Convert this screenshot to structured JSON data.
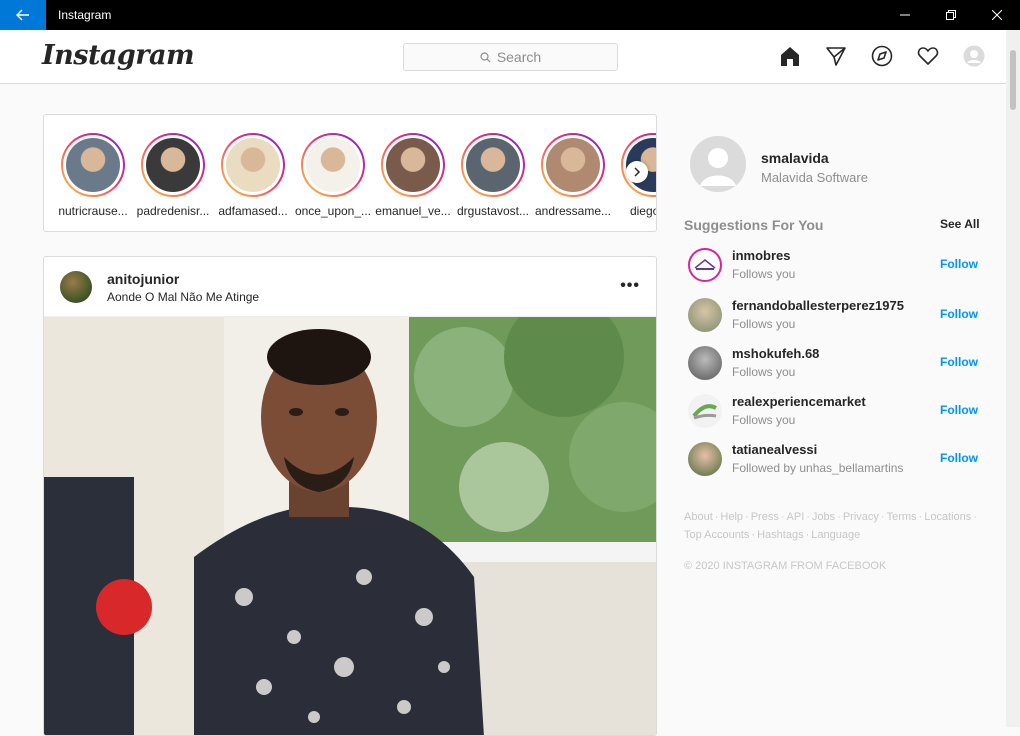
{
  "window": {
    "title": "Instagram"
  },
  "header": {
    "logo": "Instagram",
    "search_placeholder": "Search"
  },
  "stories": [
    {
      "username": "nutricrause...",
      "color": "#6b7a8a"
    },
    {
      "username": "padredenisr...",
      "color": "#3a3a3a"
    },
    {
      "username": "adfamased...",
      "color": "#e9dcc0"
    },
    {
      "username": "once_upon_...",
      "color": "#f4f1ea"
    },
    {
      "username": "emanuel_ve...",
      "color": "#7a5a4a"
    },
    {
      "username": "drgustavost...",
      "color": "#5a6570"
    },
    {
      "username": "andressame...",
      "color": "#b08a70"
    },
    {
      "username": "diego_...",
      "color": "#2a3a5a"
    }
  ],
  "post": {
    "username": "anitojunior",
    "location": "Aonde O Mal Não Me Atinge",
    "more": "•••"
  },
  "profile": {
    "username": "smalavida",
    "full_name": "Malavida Software"
  },
  "suggestions": {
    "title": "Suggestions For You",
    "see_all": "See All",
    "items": [
      {
        "username": "inmobres",
        "subtitle": "Follows you",
        "action": "Follow"
      },
      {
        "username": "fernandoballesterperez1975",
        "subtitle": "Follows you",
        "action": "Follow"
      },
      {
        "username": "mshokufeh.68",
        "subtitle": "Follows you",
        "action": "Follow"
      },
      {
        "username": "realexperiencemarket",
        "subtitle": "Follows you",
        "action": "Follow"
      },
      {
        "username": "tatianealvessi",
        "subtitle": "Followed by unhas_bellamartins",
        "action": "Follow"
      }
    ]
  },
  "footer": {
    "links": [
      "About",
      "Help",
      "Press",
      "API",
      "Jobs",
      "Privacy",
      "Terms",
      "Locations",
      "Top Accounts",
      "Hashtags",
      "Language"
    ],
    "copyright": "© 2020 INSTAGRAM FROM FACEBOOK"
  }
}
